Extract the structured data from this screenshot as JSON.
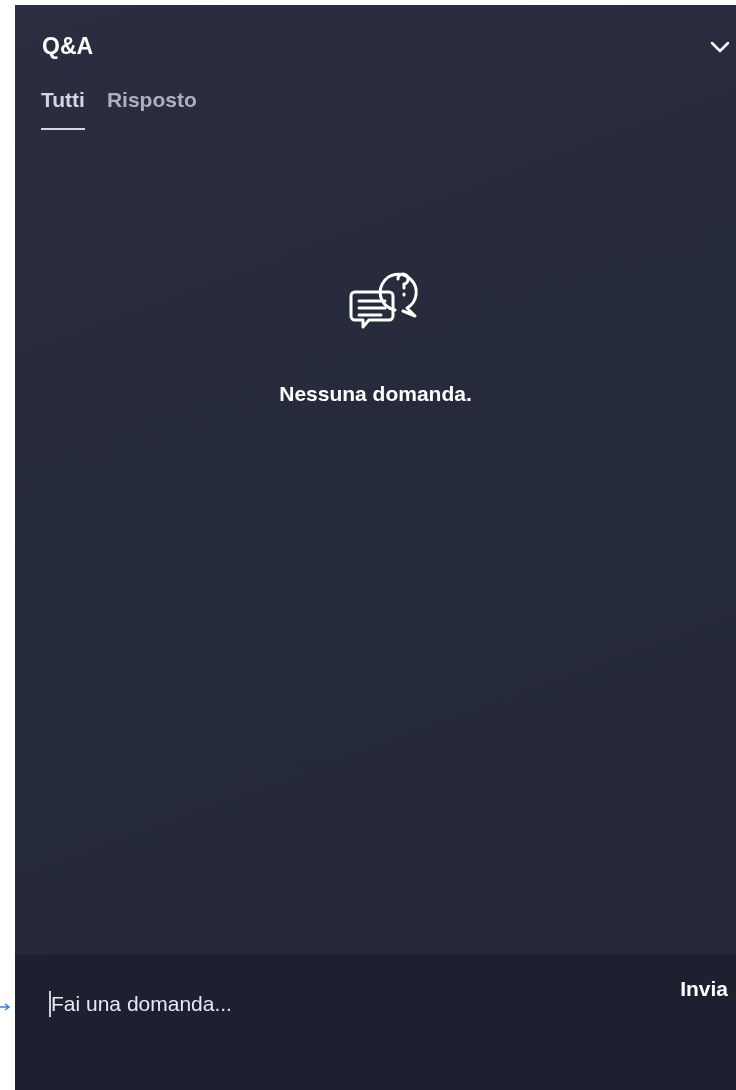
{
  "header": {
    "title": "Q&A"
  },
  "tabs": [
    {
      "label": "Tutti",
      "selected": true
    },
    {
      "label": "Risposto",
      "selected": false
    }
  ],
  "empty_state": {
    "message": "Nessuna domanda."
  },
  "composer": {
    "placeholder": "Fai una domanda...",
    "send_label": "Invia"
  }
}
